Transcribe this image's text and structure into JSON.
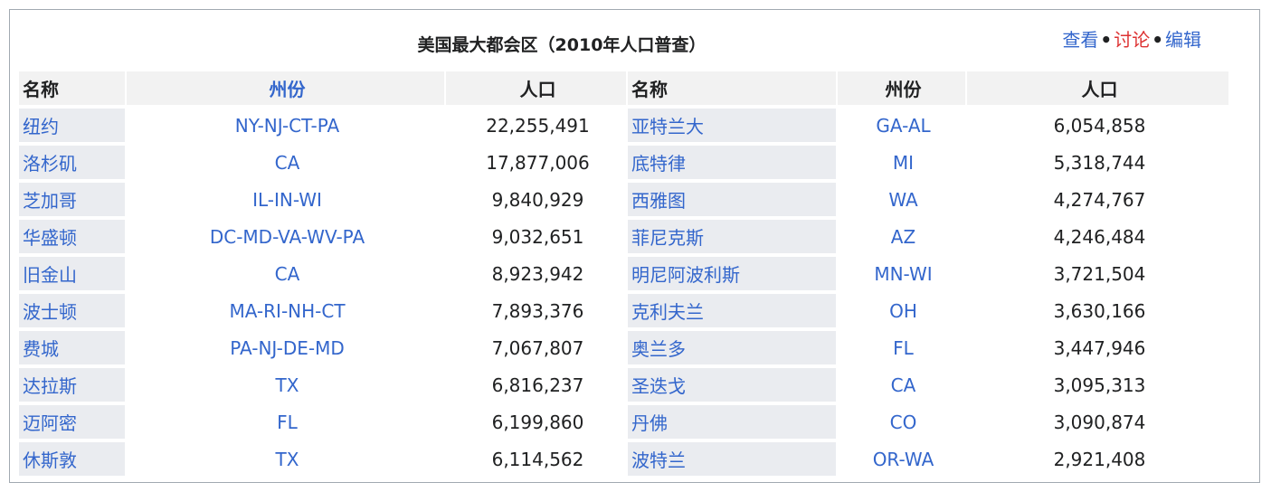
{
  "title": "美国最大都会区（2010年人口普查）",
  "links": {
    "view": "查看",
    "talk": "讨论",
    "edit": "编辑",
    "sep": "•"
  },
  "headers": {
    "name": "名称",
    "state": "州份",
    "population": "人口",
    "name2": "名称",
    "state2": "州份",
    "population2": "人口"
  },
  "left": [
    {
      "name": "纽约",
      "state": "NY-NJ-CT-PA",
      "population": "22,255,491"
    },
    {
      "name": "洛杉矶",
      "state": "CA",
      "population": "17,877,006"
    },
    {
      "name": "芝加哥",
      "state": "IL-IN-WI",
      "population": "9,840,929"
    },
    {
      "name": "华盛顿",
      "state": "DC-MD-VA-WV-PA",
      "population": "9,032,651"
    },
    {
      "name": "旧金山",
      "state": "CA",
      "population": "8,923,942"
    },
    {
      "name": "波士顿",
      "state": "MA-RI-NH-CT",
      "population": "7,893,376"
    },
    {
      "name": "费城",
      "state": "PA-NJ-DE-MD",
      "population": "7,067,807"
    },
    {
      "name": "达拉斯",
      "state": "TX",
      "population": "6,816,237"
    },
    {
      "name": "迈阿密",
      "state": "FL",
      "population": "6,199,860"
    },
    {
      "name": "休斯敦",
      "state": "TX",
      "population": "6,114,562"
    }
  ],
  "right": [
    {
      "name": "亚特兰大",
      "state": "GA-AL",
      "population": "6,054,858"
    },
    {
      "name": "底特律",
      "state": "MI",
      "population": "5,318,744"
    },
    {
      "name": "西雅图",
      "state": "WA",
      "population": "4,274,767"
    },
    {
      "name": "菲尼克斯",
      "state": "AZ",
      "population": "4,246,484"
    },
    {
      "name": "明尼阿波利斯",
      "state": "MN-WI",
      "population": "3,721,504"
    },
    {
      "name": "克利夫兰",
      "state": "OH",
      "population": "3,630,166"
    },
    {
      "name": "奥兰多",
      "state": "FL",
      "population": "3,447,946"
    },
    {
      "name": "圣迭戈",
      "state": "CA",
      "population": "3,095,313"
    },
    {
      "name": "丹佛",
      "state": "CO",
      "population": "3,090,874"
    },
    {
      "name": "波特兰",
      "state": "OR-WA",
      "population": "2,921,408"
    }
  ]
}
